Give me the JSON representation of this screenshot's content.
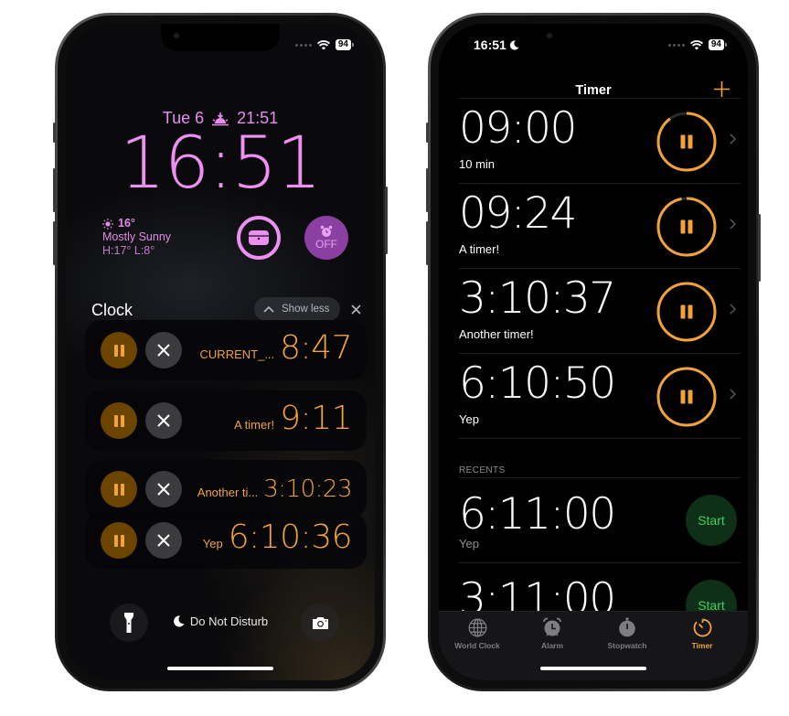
{
  "colors": {
    "lock_accent": "#ee8ff2",
    "timer_orange": "#f2a23a",
    "start_green": "#3fd15f"
  },
  "left_phone": {
    "status": {
      "battery": "94"
    },
    "date": "Tue 6",
    "sunset_time": "21:51",
    "time": "16:51",
    "weather": {
      "temperature": "16°",
      "condition": "Mostly Sunny",
      "high_low": "H:17° L:8°"
    },
    "alarm_widget": {
      "label": "OFF"
    },
    "notification_group": {
      "title": "Clock",
      "show_less_label": "Show less"
    },
    "notifications": [
      {
        "label": "CURRENT_...",
        "time": "8:47"
      },
      {
        "label": "A timer!",
        "time": "9:11"
      },
      {
        "label": "Another ti...",
        "time": "3:10:23"
      },
      {
        "label": "Yep",
        "time": "6:10:36"
      }
    ],
    "focus_label": "Do Not Disturb"
  },
  "right_phone": {
    "status": {
      "time": "16:51",
      "battery": "94"
    },
    "nav_title": "Timer",
    "active_timers": [
      {
        "time": "09:00",
        "label": "10 min",
        "progress": 0.9
      },
      {
        "time": "09:24",
        "label": "A timer!",
        "progress": 0.97
      },
      {
        "time": "3:10:37",
        "label": "Another timer!",
        "progress": 1.0
      },
      {
        "time": "6:10:50",
        "label": "Yep",
        "progress": 1.0
      }
    ],
    "recents_header": "RECENTS",
    "recents": [
      {
        "time": "6:11:00",
        "label": "Yep",
        "button": "Start"
      },
      {
        "time": "3:11:00",
        "label": "",
        "button": "Start"
      }
    ],
    "tabs": [
      {
        "label": "World Clock",
        "icon": "globe-icon",
        "active": false
      },
      {
        "label": "Alarm",
        "icon": "alarm-clock-icon",
        "active": false
      },
      {
        "label": "Stopwatch",
        "icon": "stopwatch-icon",
        "active": false
      },
      {
        "label": "Timer",
        "icon": "timer-icon",
        "active": true
      }
    ]
  }
}
